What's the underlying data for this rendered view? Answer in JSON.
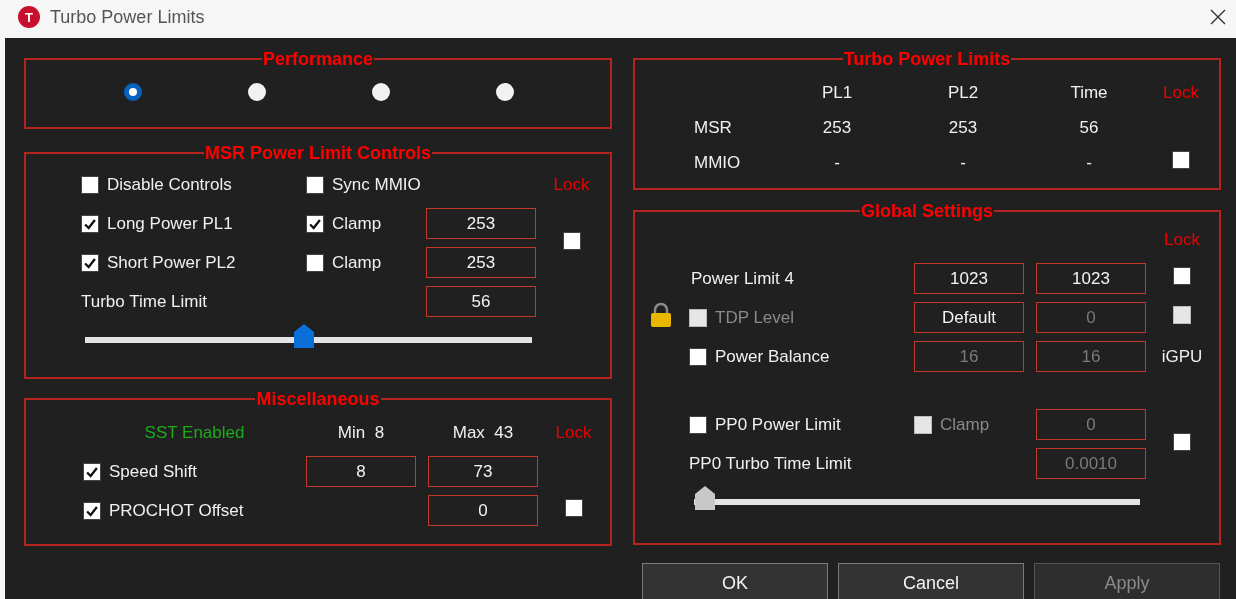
{
  "window": {
    "icon_letter": "T",
    "title": "Turbo Power Limits"
  },
  "performance": {
    "title": "Performance",
    "options": [
      {
        "selected": true
      },
      {
        "selected": false
      },
      {
        "selected": false
      },
      {
        "selected": false
      }
    ]
  },
  "msr_controls": {
    "title": "MSR Power Limit Controls",
    "lock_label": "Lock",
    "lock_checked": false,
    "disable_controls": {
      "label": "Disable Controls",
      "checked": false
    },
    "sync_mmio": {
      "label": "Sync MMIO",
      "checked": false
    },
    "limits": [
      {
        "label": "Long Power PL1",
        "checked": true,
        "clamp_label": "Clamp",
        "clamp_checked": true,
        "value": "253"
      },
      {
        "label": "Short Power PL2",
        "checked": true,
        "clamp_label": "Clamp",
        "clamp_checked": false,
        "value": "253"
      }
    ],
    "turbo_time": {
      "label": "Turbo Time Limit",
      "value": "56"
    },
    "slider": {
      "level": 0.49
    }
  },
  "miscellaneous": {
    "title": "Miscellaneous",
    "status": "SST Enabled",
    "min_label": "Min  8",
    "max_label": "Max  43",
    "lock_label": "Lock",
    "lock_checked": false,
    "speed_shift": {
      "label": "Speed Shift",
      "checked": true,
      "values": [
        "8",
        "73"
      ]
    },
    "prochot": {
      "label": "PROCHOT Offset",
      "checked": true,
      "value": "0"
    }
  },
  "turbo_power_limits": {
    "title": "Turbo Power Limits",
    "columns": [
      "PL1",
      "PL2",
      "Time"
    ],
    "lock_label": "Lock",
    "lock_checked": false,
    "rows": [
      {
        "label": "MSR",
        "values": [
          "253",
          "253",
          "56"
        ]
      },
      {
        "label": "MMIO",
        "values": [
          "-",
          "-",
          "-"
        ]
      }
    ]
  },
  "global_settings": {
    "title": "Global Settings",
    "lock_label": "Lock",
    "power_limit_4": {
      "label": "Power Limit 4",
      "values": [
        {
          "value": "1023",
          "disabled": false
        },
        {
          "value": "1023",
          "disabled": false
        }
      ],
      "lock_checked": false,
      "lock_disabled": false
    },
    "tdp_level": {
      "locked": true,
      "label": "TDP Level",
      "checked": false,
      "disabled": true,
      "values": [
        {
          "value": "Default",
          "disabled": false
        },
        {
          "value": "0",
          "disabled": true
        }
      ],
      "lock_checked": false,
      "lock_disabled": true
    },
    "power_balance": {
      "label": "Power Balance",
      "checked": false,
      "disabled": false,
      "values": [
        {
          "value": "16",
          "disabled": true
        },
        {
          "value": "16",
          "disabled": true
        }
      ],
      "suffix": "iGPU"
    },
    "pp0": {
      "label": "PP0 Power Limit",
      "checked": false,
      "disabled": false,
      "clamp_label": "Clamp",
      "clamp_checked": false,
      "clamp_disabled": true,
      "field": {
        "value": "0",
        "disabled": true
      },
      "time_label": "PP0 Turbo Time Limit",
      "time_field": {
        "value": "0.0010",
        "disabled": true
      },
      "lock_checked": false,
      "slider": {
        "level": 0
      }
    }
  },
  "buttons": [
    {
      "label": "OK",
      "disabled": false
    },
    {
      "label": "Cancel",
      "disabled": false
    },
    {
      "label": "Apply",
      "disabled": true
    }
  ]
}
